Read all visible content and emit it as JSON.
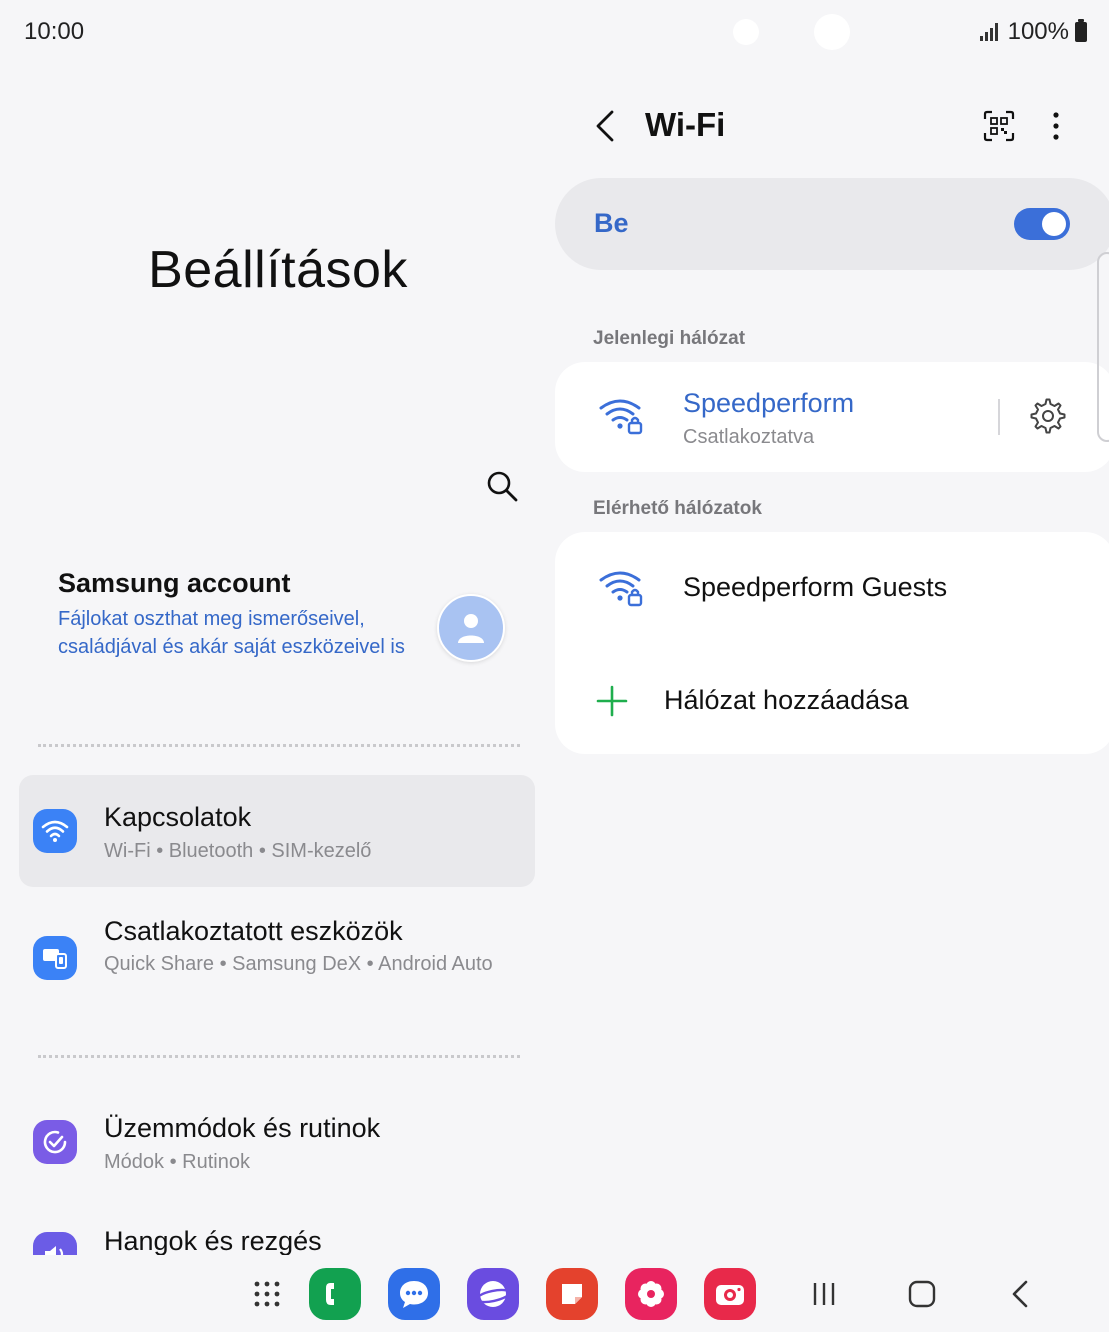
{
  "status_bar": {
    "time": "10:00",
    "battery": "100%"
  },
  "left_pane": {
    "title": "Beállítások",
    "account": {
      "title": "Samsung account",
      "subtitle": "Fájlokat oszthat meg ismerőseivel, családjával és akár saját eszközeivel is"
    },
    "menu": [
      {
        "title": "Kapcsolatok",
        "subtitle": "Wi-Fi  •  Bluetooth  •  SIM-kezelő",
        "icon": "wifi-icon",
        "color": "#3b82f6",
        "active": true
      },
      {
        "title": "Csatlakoztatott eszközök",
        "subtitle": "Quick Share  •  Samsung DeX  •  Android Auto",
        "icon": "devices-icon",
        "color": "#3b82f6",
        "active": false
      },
      {
        "title": "Üzemmódok és rutinok",
        "subtitle": "Módok  •  Rutinok",
        "icon": "routine-check-icon",
        "color": "#7a5ce6",
        "active": false
      },
      {
        "title": "Hangok és rezgés",
        "subtitle": "",
        "icon": "sound-icon",
        "color": "#6b5ce6",
        "active": false
      }
    ]
  },
  "right_pane": {
    "title": "Wi-Fi",
    "toggle": {
      "label": "Be",
      "on": true
    },
    "current_section": "Jelenlegi hálózat",
    "current_network": {
      "name": "Speedperform",
      "status": "Csatlakoztatva"
    },
    "available_section": "Elérhető hálózatok",
    "available_networks": [
      {
        "name": "Speedperform Guests"
      }
    ],
    "add_network": "Hálózat hozzáadása"
  },
  "dock": {
    "apps": [
      {
        "name": "phone",
        "color": "#12a150"
      },
      {
        "name": "messages",
        "color": "#2f6fe8"
      },
      {
        "name": "internet",
        "color": "#6a4ce0"
      },
      {
        "name": "notes",
        "color": "#e4422d"
      },
      {
        "name": "gallery",
        "color": "#e8245f"
      },
      {
        "name": "camera",
        "color": "#e8294a"
      }
    ]
  },
  "colors": {
    "accent": "#3568c8",
    "toggle_on": "#3b6fd9",
    "add_green": "#1fae4d"
  }
}
